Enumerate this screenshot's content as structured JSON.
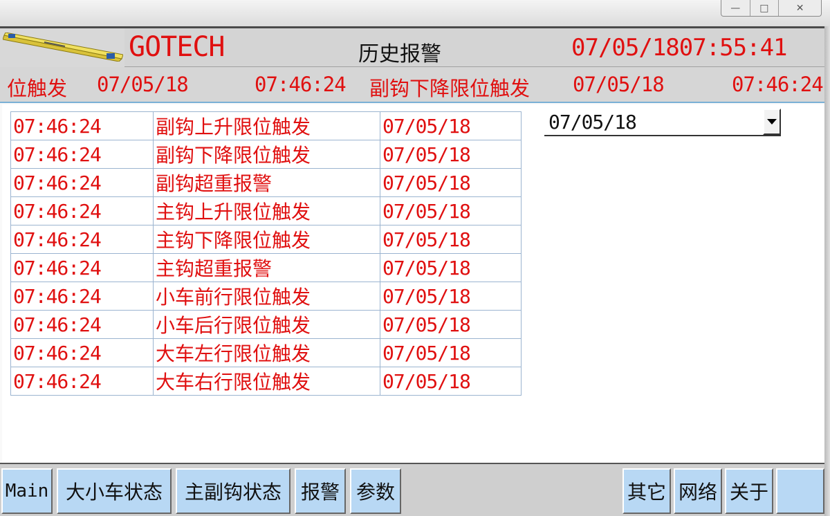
{
  "window": {
    "buttons": [
      "minimize",
      "maximize",
      "close"
    ]
  },
  "header": {
    "brand": "GOTECH",
    "page_title": "历史报警",
    "clock": "07/05/1807:55:41"
  },
  "ticker": {
    "items": [
      "位触发",
      "07/05/18",
      "07:46:24",
      "副钩下降限位触发",
      "07/05/18",
      "07:46:24"
    ]
  },
  "alarms": {
    "rows": [
      {
        "time": "07:46:24",
        "desc": "副钩上升限位触发",
        "date": "07/05/18"
      },
      {
        "time": "07:46:24",
        "desc": "副钩下降限位触发",
        "date": "07/05/18"
      },
      {
        "time": "07:46:24",
        "desc": "副钩超重报警",
        "date": "07/05/18"
      },
      {
        "time": "07:46:24",
        "desc": "主钩上升限位触发",
        "date": "07/05/18"
      },
      {
        "time": "07:46:24",
        "desc": "主钩下降限位触发",
        "date": "07/05/18"
      },
      {
        "time": "07:46:24",
        "desc": "主钩超重报警",
        "date": "07/05/18"
      },
      {
        "time": "07:46:24",
        "desc": "小车前行限位触发",
        "date": "07/05/18"
      },
      {
        "time": "07:46:24",
        "desc": "小车后行限位触发",
        "date": "07/05/18"
      },
      {
        "time": "07:46:24",
        "desc": "大车左行限位触发",
        "date": "07/05/18"
      },
      {
        "time": "07:46:24",
        "desc": "大车右行限位触发",
        "date": "07/05/18"
      }
    ]
  },
  "date_filter": {
    "selected": "07/05/18"
  },
  "nav": {
    "main": "Main",
    "trolley_status": "大小车状态",
    "hook_status": "主副钩状态",
    "alarm": "报警",
    "params": "参数",
    "other": "其它",
    "network": "网络",
    "about": "关于",
    "blank": ""
  },
  "colors": {
    "alarm_text": "#e01010",
    "nav_button": "#b8d8f4",
    "table_border": "#9bb4d0"
  }
}
